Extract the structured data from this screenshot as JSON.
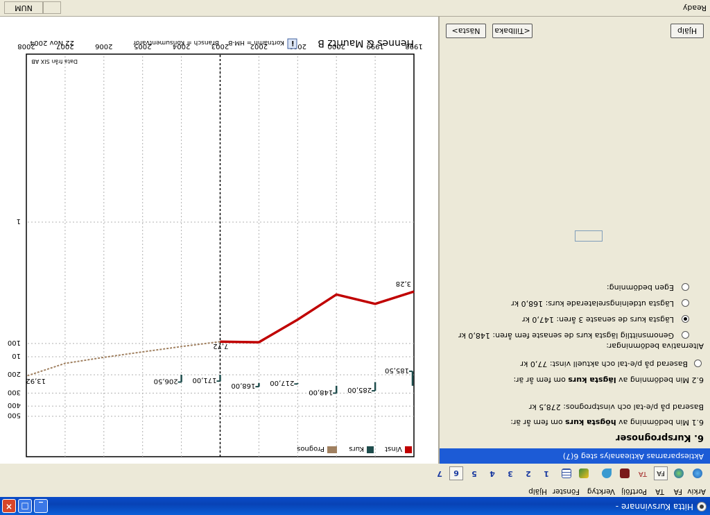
{
  "window": {
    "title": "Hitta Kursvinnare -",
    "buttons": {
      "minimize": "_",
      "maximize": "□",
      "close": "×"
    }
  },
  "menu": [
    "Arkiv",
    "FA",
    "TA",
    "Portfölj",
    "Verktyg",
    "Fönster",
    "Hjälp"
  ],
  "toolbar": {
    "steps": [
      "1",
      "2",
      "3",
      "4",
      "5",
      "6",
      "7"
    ],
    "selected_step": "6",
    "icons": [
      "globe-icon",
      "globe-icon",
      "fa-icon",
      "ta-icon",
      "book-icon",
      "pin-icon",
      "pencil-icon",
      "table-icon"
    ]
  },
  "left": {
    "header": "Aktiespararnas Aktieanalys steg 6(7)",
    "heading": "6. Kursprognoser",
    "q1_prefix": "6.1 Min bedömning av ",
    "q1_bold": "högsta kurs",
    "q1_suffix": " om fem år är:",
    "q1_value": "Baserad på p/e-tal och vinstprognos:  278,5 kr",
    "q2_prefix": "6.2 Min bedömning av ",
    "q2_bold": "lägsta kurs",
    "q2_suffix": " om fem år är:",
    "opt_pe": "Baserad på p/e-tal och aktuell vinst:  77,0 kr",
    "alt_label": "Alternativa bedömningar:",
    "opt_avg": "Genomsnittlig lägsta kurs de senaste fem åren:  148,0 kr",
    "opt_3yr": "Lägsta kurs de senaste 3 åren:  147,0 kr",
    "opt_div": "Lägsta utdelningsrelaterade kurs:  168,0 kr",
    "opt_own": "Egen bedömning:",
    "own_value": "",
    "selected_option": "3yr",
    "btn_help": "Hjälp",
    "btn_back": "<Tillbaka",
    "btn_next": "Nästa>"
  },
  "chart": {
    "company": "Hennes & Mauritz B",
    "info_badge": "i",
    "short_name": "Kortnamn = HM-B",
    "sector": "Bransch = Konsumentvaror",
    "date": "22 Nov 2004",
    "source": "Data från SIX AB",
    "legend": [
      "Vinst",
      "Kurs",
      "Prognos"
    ],
    "colors": {
      "vinst": "#c00000",
      "kurs": "#1e4d4d",
      "prognos": "#a08060",
      "grid": "#b0b0b0"
    }
  },
  "chart_data": {
    "type": "line",
    "x": [
      1998,
      1999,
      2000,
      2001,
      2002,
      2003,
      2004,
      2005,
      2006,
      2007,
      2008
    ],
    "axis_top_labels": [
      "1998",
      "1999",
      "2000",
      "2001",
      "2002",
      "2003",
      "2004",
      "2005",
      "2006",
      "2007",
      "2008"
    ],
    "eps_ticks": [
      "1",
      "10"
    ],
    "price_ticks": [
      "100",
      "200",
      "300",
      "400",
      "500"
    ],
    "log_scale": true,
    "forecast_start": 2003,
    "series": [
      {
        "name": "Vinst",
        "x": [
          1998,
          1999,
          2000,
          2001,
          2002,
          2003
        ],
        "values": [
          3.28,
          4.05,
          3.45,
          5.3,
          7.8,
          7.72
        ]
      },
      {
        "name": "Prognos",
        "x": [
          2003,
          2004,
          2005,
          2006,
          2007,
          2008
        ],
        "values": [
          7.72,
          8.4,
          9.2,
          10.1,
          11.2,
          13.92
        ]
      },
      {
        "name": "Kurs",
        "x": [
          1998,
          1999,
          2000,
          2001,
          2002,
          2003,
          2004
        ],
        "high": [
          255,
          235,
          255,
          240,
          240,
          200,
          200
        ],
        "low": [
          185,
          285,
          300,
          245,
          260,
          230,
          235
        ],
        "labels": [
          "185,50",
          "285,00",
          "148,00",
          "217,00",
          "168,00",
          "171,00",
          "206,50"
        ]
      }
    ]
  }
}
